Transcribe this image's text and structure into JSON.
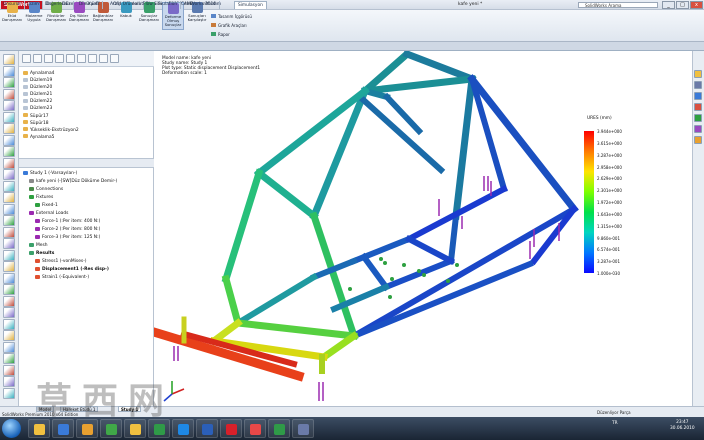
{
  "app": {
    "logo_text": "SolidWorks",
    "document_title": "kafe yeni *",
    "menu": [
      "Dosya",
      "Düzenle",
      "Görünüm",
      "Ekle",
      "Araçlar",
      "Simulation",
      "Flow Simulation",
      "CAMWorks",
      "Pencere",
      "Yardım"
    ],
    "search_placeholder": "SolidWorks Arama",
    "window_buttons": [
      "_",
      "□",
      "x"
    ]
  },
  "ribbon": {
    "buttons": [
      {
        "label": "Etüd Danışmanı",
        "color": "#e8b24a"
      },
      {
        "label": "Malzeme Uygula",
        "color": "#5a86c8"
      },
      {
        "label": "Fikstürler Danışmanı",
        "color": "#6fae48"
      },
      {
        "label": "Dış Yükler Danışmanı",
        "color": "#9a4ac0"
      },
      {
        "label": "Bağlantılar Danışmanı",
        "color": "#c05a3a"
      },
      {
        "label": "Kabuk",
        "color": "#3a9ac0"
      },
      {
        "label": "Sonuçlar Danışmanı",
        "color": "#3aa06a"
      },
      {
        "label": "Deforme Olmuş Sonuçlar",
        "color": "#7a6ac8"
      },
      {
        "label": "Sonuçları Karşılaştır",
        "color": "#5a7ab0"
      }
    ],
    "small_buttons": [
      "Tasarım İçgörüsü",
      "Grafik Araçları",
      "Rapor"
    ]
  },
  "tabs": {
    "items": [
      "Unsurlar",
      "Çizim",
      "Değerlendir",
      "DimXpert",
      "Ofis Ürünleri",
      "Flow Simulation",
      "CAMWorks 2010",
      "Simulasyon"
    ],
    "active": "Simulasyon"
  },
  "feature_tree": {
    "items": [
      "Aynalama4",
      "Düzlem19",
      "Düzlem20",
      "Düzlem21",
      "Düzlem22",
      "Düzlem23",
      "Süpür17",
      "Süpür18",
      "Yükseklik-Ekstrüzyon2",
      "Aynalama5"
    ]
  },
  "study_tree": {
    "items": [
      {
        "label": "Study 1 (-Varsayılan-)",
        "indent": 0,
        "bold": false
      },
      {
        "label": "kafe yeni (-[SW]Düz Döküme Demir-)",
        "indent": 1,
        "bold": false
      },
      {
        "label": "Connections",
        "indent": 1,
        "bold": false
      },
      {
        "label": "Fixtures",
        "indent": 1,
        "bold": false
      },
      {
        "label": "Fixed-1",
        "indent": 2,
        "bold": false
      },
      {
        "label": "External Loads",
        "indent": 1,
        "bold": false
      },
      {
        "label": "Force-1 (:Per item: 400 N:)",
        "indent": 2,
        "bold": false
      },
      {
        "label": "Force-2 (:Per item: 800 N:)",
        "indent": 2,
        "bold": false
      },
      {
        "label": "Force-3 (:Per item: 125 N:)",
        "indent": 2,
        "bold": false
      },
      {
        "label": "Mesh",
        "indent": 1,
        "bold": false
      },
      {
        "label": "Results",
        "indent": 1,
        "bold": true
      },
      {
        "label": "Stress1 (-vonMises-)",
        "indent": 2,
        "bold": false
      },
      {
        "label": "Displacement1 (-Res disp-)",
        "indent": 2,
        "bold": true
      },
      {
        "label": "Strain1 (-Equivalent-)",
        "indent": 2,
        "bold": false
      }
    ]
  },
  "model_info": {
    "lines": [
      "Model name: kafe yeni",
      "Study name: Study 1",
      "Plot type: Static displacement Displacement1",
      "Deformation scale: 1"
    ]
  },
  "legend": {
    "title": "URES (mm)",
    "ticks": [
      "3.944e+000",
      "3.615e+000",
      "3.287e+000",
      "2.958e+000",
      "2.629e+000",
      "2.301e+000",
      "1.972e+000",
      "1.643e+000",
      "1.315e+000",
      "9.860e-001",
      "6.574e-001",
      "3.287e-001",
      "1.000e-030"
    ]
  },
  "bottom_tabs": [
    "Model",
    "Hareket Etüdü 1",
    "Study 1"
  ],
  "status": {
    "left": "SolidWorks Premium 2010 x64 Edition",
    "right": "Düzenliyor Parça"
  },
  "taskbar": {
    "apps": [
      {
        "name": "explorer",
        "color": "#f0c040"
      },
      {
        "name": "media",
        "color": "#3a7ad8"
      },
      {
        "name": "folder",
        "color": "#e8a030"
      },
      {
        "name": "chrome",
        "color": "#40a848"
      },
      {
        "name": "explorer2",
        "color": "#f0c040"
      },
      {
        "name": "excel",
        "color": "#2f9a48"
      },
      {
        "name": "ie",
        "color": "#1e88e5"
      },
      {
        "name": "word",
        "color": "#2b5fb8"
      },
      {
        "name": "solidworks",
        "color": "#d8202a"
      },
      {
        "name": "paint",
        "color": "#e84848"
      },
      {
        "name": "excel2",
        "color": "#2f9a48"
      },
      {
        "name": "calc",
        "color": "#6a7aa8"
      }
    ],
    "tray": "TR",
    "time": "23:47",
    "date": "30.06.2010"
  },
  "watermark": "草西网"
}
